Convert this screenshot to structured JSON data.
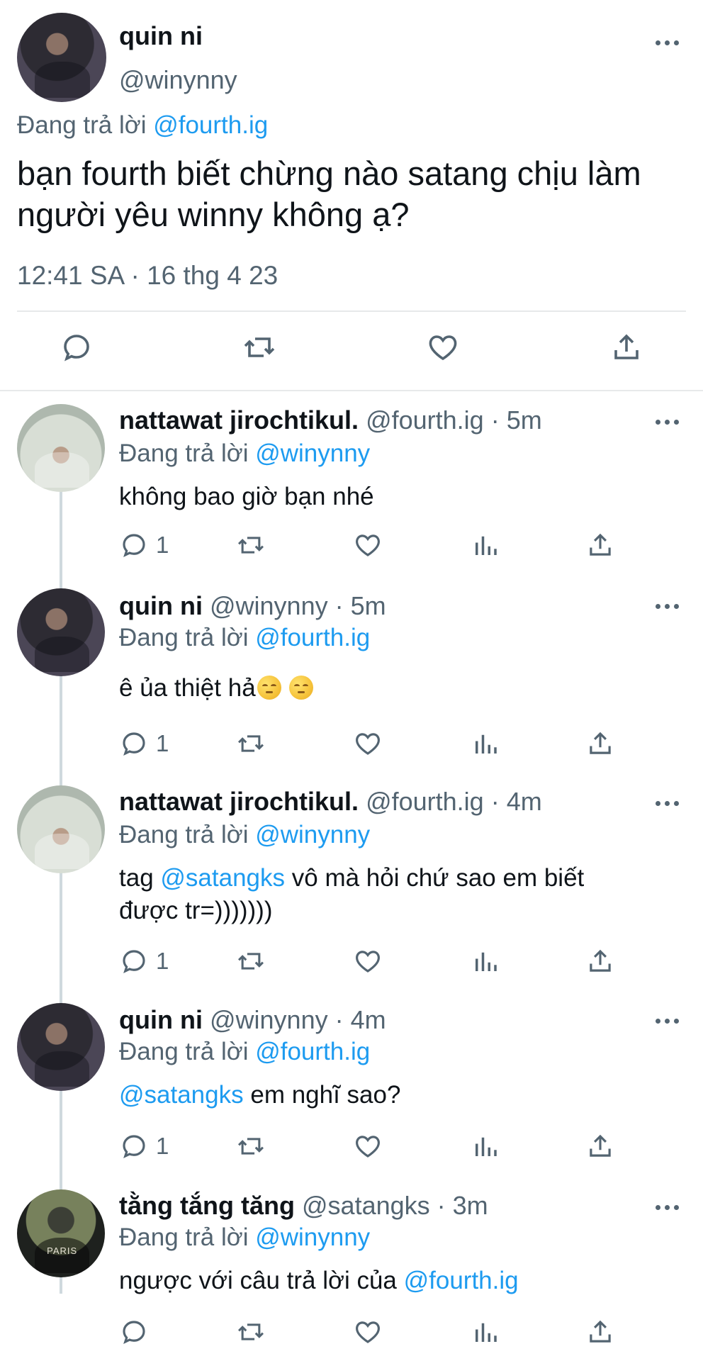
{
  "main_tweet": {
    "author_name": "quin ni",
    "author_handle": "@winynny",
    "reply_prefix": "Đang trả lời",
    "reply_to": "@fourth.ig",
    "text": "bạn fourth biết chừng nào satang chịu làm người yêu winny không ạ?",
    "timestamp": "12:41 SA · 16 thg 4 23",
    "icons": [
      "reply-icon",
      "retweet-icon",
      "like-icon",
      "share-icon"
    ]
  },
  "replies": [
    {
      "name": "nattawat jirochtikul.",
      "handle": "@fourth.ig",
      "time": "· 5m",
      "reply_prefix": "Đang trả lời",
      "reply_to": "@winynny",
      "text": "không bao giờ bạn nhé",
      "reply_count": "1"
    },
    {
      "name": "quin ni",
      "handle": "@winynny",
      "time": "· 5m",
      "reply_prefix": "Đang trả lời",
      "reply_to": "@fourth.ig",
      "text": "ê ủa thiệt hả",
      "emoji": "pensive-face-emoji",
      "reply_count": "1"
    },
    {
      "name": "nattawat jirochtikul.",
      "handle": "@fourth.ig",
      "time": "· 4m",
      "reply_prefix": "Đang trả lời",
      "reply_to": "@winynny",
      "text_before": "tag",
      "mention": "@satangks",
      "text_after": "vô mà hỏi chứ sao em biết",
      "text_line2": "được tr=)))))))",
      "reply_count": "1"
    },
    {
      "name": "quin ni",
      "handle": "@winynny",
      "time": "· 4m",
      "reply_prefix": "Đang trả lời",
      "reply_to": "@fourth.ig",
      "mention": "@satangks",
      "text_after": "em nghĩ sao?",
      "reply_count": "1"
    },
    {
      "name": "tằng tắng tăng",
      "handle": "@satangks",
      "time": "· 3m",
      "reply_prefix": "Đang trả lời",
      "reply_to": "@winynny",
      "text_before": "ngược với câu trả lời của",
      "mention": "@fourth.ig",
      "reply_count": ""
    }
  ],
  "avatar_labels": {
    "satang_shirt_text": "PARIS"
  },
  "colors": {
    "link": "#1d9bf0",
    "muted": "#536471",
    "text": "#0f1419",
    "divider": "#e7e9ea"
  }
}
